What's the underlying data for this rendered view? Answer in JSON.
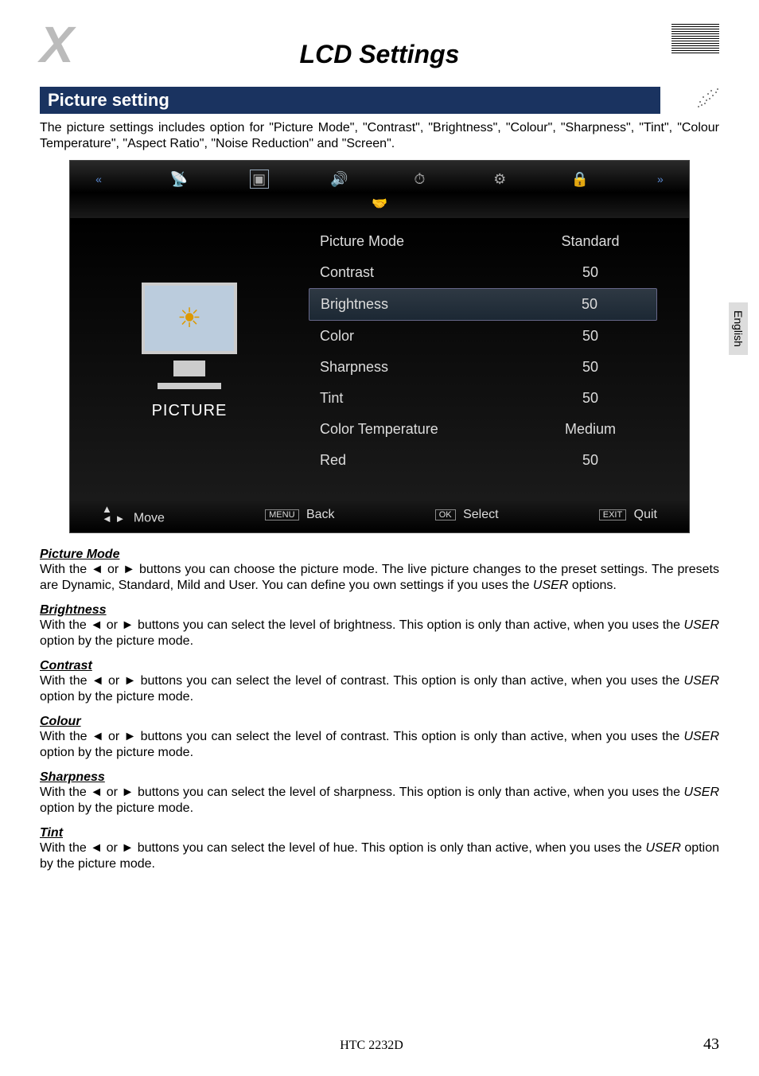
{
  "page_title": "LCD Settings",
  "section_header": "Picture setting",
  "intro_text": "The picture settings includes option for \"Picture Mode\", \"Contrast\", \"Brightness\", \"Colour\", \"Sharpness\", \"Tint\", \"Colour Temperature\", \"Aspect Ratio\", \"Noise Reduction\" and \"Screen\".",
  "side_tab": "English",
  "osd": {
    "left_label": "PICTURE",
    "top_icons": [
      "«",
      "channel",
      "picture",
      "sound",
      "timer",
      "setup",
      "lock",
      "»"
    ],
    "rows": [
      {
        "label": "Picture Mode",
        "value": "Standard",
        "highlight": false
      },
      {
        "label": "Contrast",
        "value": "50",
        "highlight": false
      },
      {
        "label": "Brightness",
        "value": "50",
        "highlight": true
      },
      {
        "label": "Color",
        "value": "50",
        "highlight": false
      },
      {
        "label": "Sharpness",
        "value": "50",
        "highlight": false
      },
      {
        "label": "Tint",
        "value": "50",
        "highlight": false
      },
      {
        "label": "Color Temperature",
        "value": "Medium",
        "highlight": false
      },
      {
        "label": "Red",
        "value": "50",
        "highlight": false
      }
    ],
    "bottom": {
      "move": "Move",
      "back_cap": "MENU",
      "back": "Back",
      "select_cap": "OK",
      "select": "Select",
      "quit_cap": "EXIT",
      "quit": "Quit"
    }
  },
  "subsections": [
    {
      "heading": "Picture Mode",
      "body_pre": "With the ◄ or ► buttons you can choose the picture mode. The live picture changes to the preset settings. The presets are Dynamic, Standard, Mild and User. You can define you own settings if you uses the ",
      "user": "USER",
      "body_post": " options."
    },
    {
      "heading": "Brightness",
      "body_pre": "With the ◄ or ► buttons you can select the level of brightness. This option is only than active, when you uses the ",
      "user": "USER",
      "body_post": " option by the picture mode."
    },
    {
      "heading": "Contrast",
      "body_pre": "With the ◄ or ► buttons you can select the level of contrast. This option is only than active, when you uses the ",
      "user": "USER",
      "body_post": " option by the picture mode."
    },
    {
      "heading": "Colour",
      "body_pre": "With the ◄ or ► buttons you can select the level of contrast. This option is only than active, when you uses the ",
      "user": "USER",
      "body_post": " option by the picture mode."
    },
    {
      "heading": "Sharpness",
      "body_pre": "With the ◄ or ► buttons you can select the level of sharpness. This option is only than active, when you uses the ",
      "user": "USER",
      "body_post": " option by the picture mode."
    },
    {
      "heading": "Tint",
      "body_pre": "With the ◄ or ► buttons you can select the level of hue. This option is only than active, when you uses the ",
      "user": "USER",
      "body_post": " option by the picture mode."
    }
  ],
  "footer": {
    "model": "HTC 2232D",
    "page": "43"
  }
}
